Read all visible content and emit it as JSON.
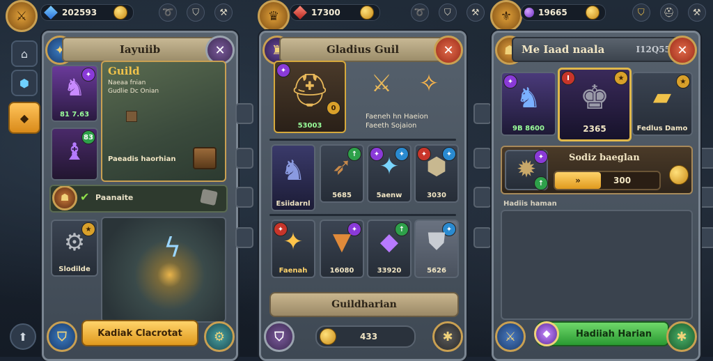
{
  "left_panel": {
    "resource_gold": "202593",
    "title": "Iayuiib",
    "guild_title": "Guild",
    "guild_sub": "Naeaa fnian\nGudlie Dc Onian",
    "level_badge": "83",
    "hero_value": "81 7.63",
    "map_label": "Paeadis haorhian",
    "quest_label": "Paanaite",
    "item_label": "Slodilde",
    "action_button": "Kadiak Clacrotat"
  },
  "middle_panel": {
    "resource_gold": "17300",
    "title": "Gladius Guil",
    "featured_value": "53003",
    "offer_text": "Faeneh hn Haeion\nFaeeth Sojaion",
    "items_row1": [
      "Esiidarnl",
      "5685",
      "5aenw",
      "3030"
    ],
    "items_row2": [
      "Faenah",
      "16080",
      "33920",
      "5626"
    ],
    "main_button": "Guildharian",
    "counter_value": "433"
  },
  "right_panel": {
    "resource_gems": "19665",
    "title": "Me Iaad naala",
    "title_code": "I12Q55",
    "hero1_value": "9B 8600",
    "hero2_value": "2365",
    "chest_label": "Fedlus Damo",
    "upgrade_title": "Sodiz baeglan",
    "bar_value": "300",
    "log_label": "Hadiis haman",
    "action_button": "Hadiiah Harian"
  },
  "colors": {
    "gold": "#e09a1e",
    "green": "#2a9a32",
    "close_red": "#9a2a18",
    "panel": "#4a5560"
  }
}
